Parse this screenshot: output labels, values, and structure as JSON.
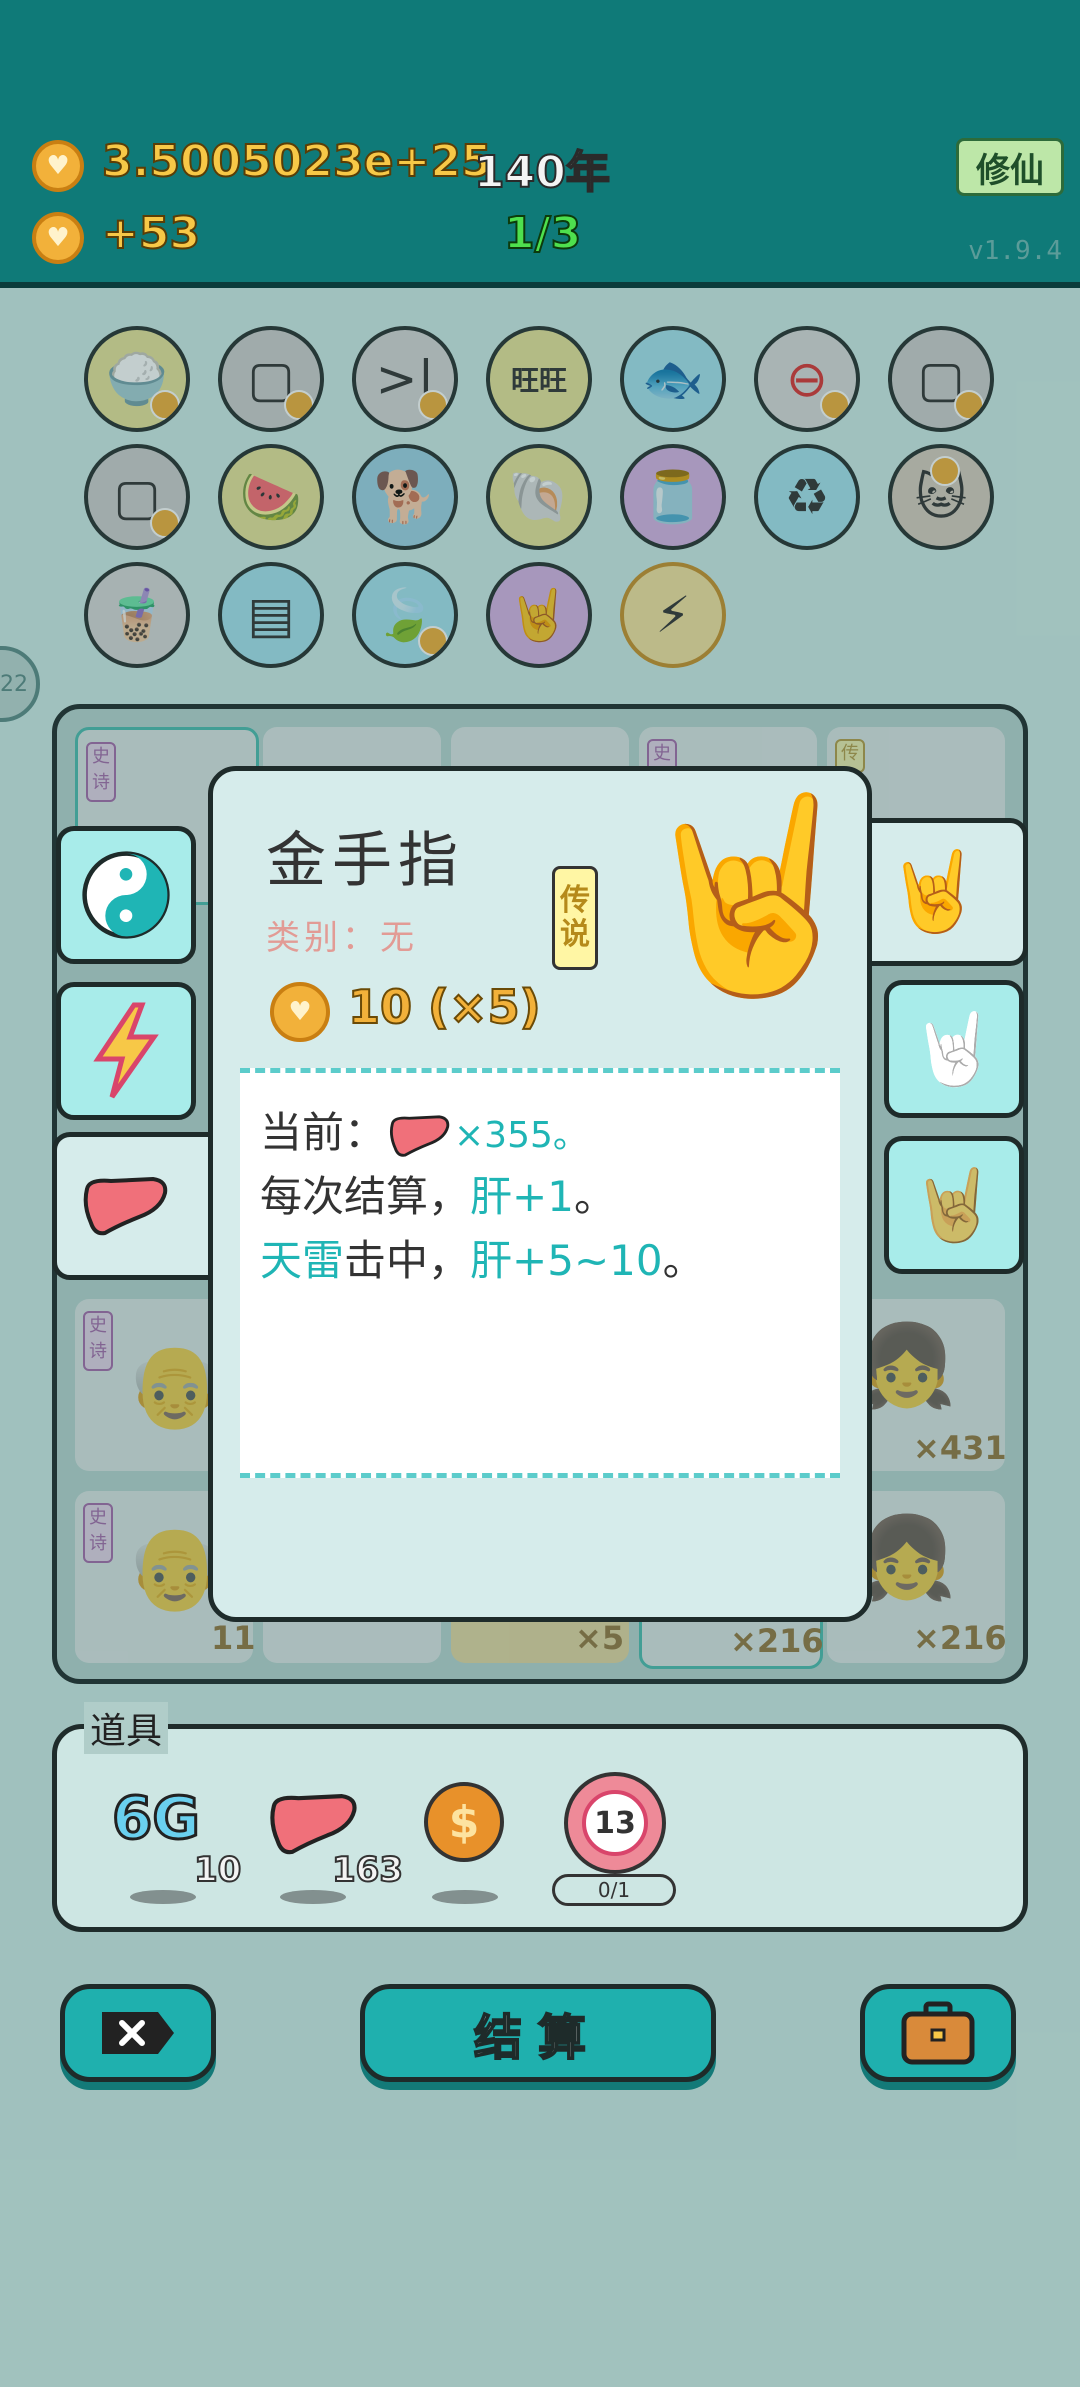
{
  "header": {
    "total_money": "3.5005023e+25",
    "years": "140年",
    "income": "+53",
    "progress": "1/3",
    "xiuxian_label": "修仙",
    "version": "v1.9.4"
  },
  "side_badge": "22",
  "icon_grid": [
    [
      "rice-bowl-icon",
      "tofu-blocks-icon",
      "skip-icon",
      "wang-tiles-icon",
      "fishbowl-icon",
      "minus-sign-icon",
      "tofu-blocks-icon"
    ],
    [
      "tofu-blocks-icon",
      "fruit-basket-icon",
      "dog-sunglasses-icon",
      "shell-icon",
      "jar-icon",
      "recycle-bag-icon",
      "cat-glasses-icon"
    ],
    [
      "bubble-tea-icon",
      "pleated-skirt-icon",
      "leaf-icon",
      "rock-hand-icon",
      "lightning-icon"
    ]
  ],
  "board": {
    "tag_shishi": "史诗",
    "tag_chuanshuo": "传",
    "counts": [
      "×431",
      "11",
      "×5",
      "×216",
      "×216"
    ]
  },
  "dialog": {
    "title": "金手指",
    "category": "类别：无",
    "rarity": "传说",
    "cost": "10 (×5)",
    "line1_prefix": "当前：",
    "line1_value": "×355。",
    "line2_prefix": "每次结算，",
    "line2_teal": "肝+1",
    "line2_suffix": "。",
    "line3_teal1": "天雷",
    "line3_mid": "击中，",
    "line3_teal2": "肝+5~10",
    "line3_suffix": "。"
  },
  "items": {
    "label": "道具",
    "entries": [
      {
        "name": "6G",
        "count": "10"
      },
      {
        "name": "liver",
        "count": "163"
      },
      {
        "name": "dollar-coin",
        "count": ""
      },
      {
        "name": "timer",
        "value": "13",
        "sub": "0/1"
      }
    ]
  },
  "buttons": {
    "settle": "结算"
  },
  "colors": {
    "header": "#0f7a78",
    "accent_teal": "#1fb5b5",
    "gold": "#f2b13a",
    "dialog_bg": "#d6eceb"
  }
}
